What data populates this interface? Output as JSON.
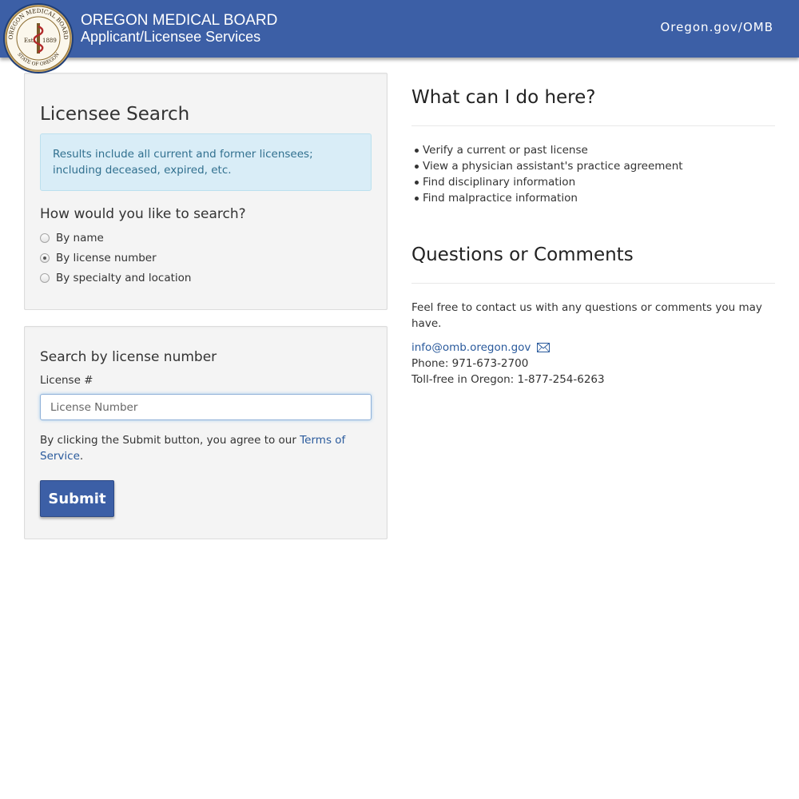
{
  "header": {
    "title": "OREGON MEDICAL BOARD",
    "subtitle": "Applicant/Licensee Services",
    "link": "Oregon.gov/OMB",
    "seal": {
      "top_text": "OREGON MEDICAL BOARD",
      "bottom_text": "STATE OF OREGON",
      "est": "Est.",
      "year": "1889"
    },
    "color": "#3c5fa6"
  },
  "search_panel": {
    "title": "Licensee Search",
    "info": "Results include all current and former licensees; including deceased, expired, etc.",
    "question": "How would you like to search?",
    "options": [
      {
        "label": "By name",
        "checked": false
      },
      {
        "label": "By license number",
        "checked": true
      },
      {
        "label": "By specialty and location",
        "checked": false
      }
    ]
  },
  "license_panel": {
    "title": "Search by license number",
    "field_label": "License #",
    "placeholder": "License Number",
    "value": "",
    "terms_prefix": "By clicking the Submit button, you agree to our ",
    "terms_link": "Terms of Service",
    "terms_suffix": ".",
    "submit_label": "Submit"
  },
  "what": {
    "title": "What can I do here?",
    "items": [
      "Verify a current or past license",
      "View a physician assistant's practice agreement",
      "Find disciplinary information",
      "Find malpractice information"
    ]
  },
  "questions": {
    "title": "Questions or Comments",
    "intro": "Feel free to contact us with any questions or comments you may have.",
    "email": "info@omb.oregon.gov",
    "phone": "Phone: 971-673-2700",
    "tollfree": "Toll-free in Oregon: 1-877-254-6263"
  },
  "icons": {
    "seal": "oregon-medical-board-seal",
    "email": "envelope-icon"
  }
}
